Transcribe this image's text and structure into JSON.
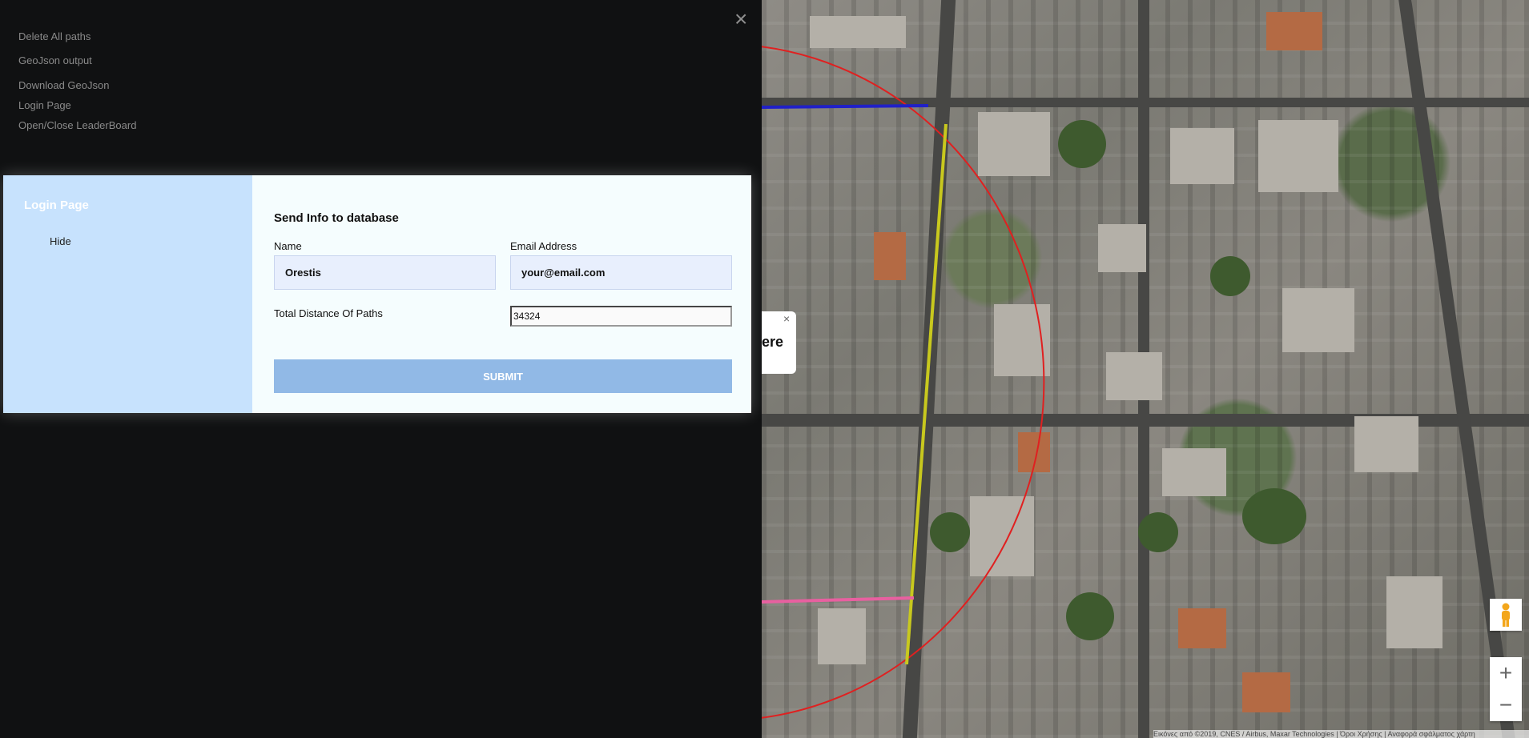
{
  "sidenav": {
    "close_glyph": "×",
    "links": [
      {
        "label": "Delete All paths"
      },
      {
        "label": "GeoJson output"
      },
      {
        "label": "Download GeoJson"
      },
      {
        "label": "Login Page"
      },
      {
        "label": "Open/Close LeaderBoard"
      }
    ]
  },
  "modal": {
    "side_title": "Login Page",
    "hide_label": "Hide",
    "form_title": "Send Info to database",
    "name_label": "Name",
    "name_value": "Orestis",
    "email_label": "Email Address",
    "email_value": "your@email.com",
    "distance_label": "Total Distance Of Paths",
    "distance_value": "34324",
    "submit_label": "SUBMIT"
  },
  "map": {
    "popup_text": "ere",
    "popup_close": "×",
    "zoom_in": "+",
    "zoom_out": "−",
    "attribution": "Εικόνες από ©2019, CNES / Airbus, Maxar Technologies | Όροι Χρήσης | Αναφορά σφάλματος χάρτη",
    "path_colors": {
      "circle": "#e02020",
      "yellow": "#c8c81e",
      "blue": "#2020c8",
      "pink": "#e860a0"
    }
  }
}
